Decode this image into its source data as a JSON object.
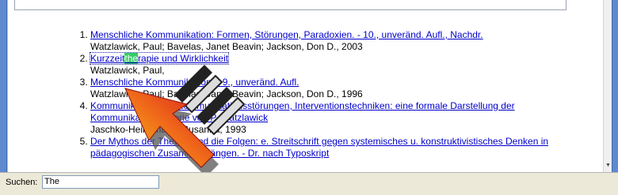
{
  "search": {
    "label": "Suchen:",
    "value": "The",
    "placeholder": ""
  },
  "results": [
    {
      "number": "1.",
      "title": "Menschliche Kommunikation: Formen, Störungen, Paradoxien. - 10., unveränd. Aufl., Nachdr.",
      "authors": "Watzlawick, Paul; Bavelas, Janet Beavin; Jackson, Don D., 2003"
    },
    {
      "number": "2.",
      "title_pre": "Kurzzeit",
      "title_hl": "the",
      "title_post": "rapie und Wirklichkeit",
      "authors": "Watzlawick, Paul,"
    },
    {
      "number": "3.",
      "title": "Menschliche Kommunikation. - 9., unveränd. Aufl.",
      "authors": "Watzlawick, Paul; Bavelas, Janet Beavin; Jackson, Don D., 1996"
    },
    {
      "number": "4.",
      "title": "Kommunikation und Kommunikationsstörungen, Interventionstechniken: eine formale Darstellung der Kommunikationstheorie von P. Watzlawick",
      "authors": "Jaschko-Heinemann, Susanna, 1993"
    },
    {
      "number": "5.",
      "title": "Der Mythos der Theorie und die Folgen: e. Streitschrift gegen systemisches u. konstruktivistisches Denken in pädagogischen Zusammenhängen. - Dr. nach Typoskript",
      "authors": ""
    }
  ],
  "overlay": {
    "icon": "red-arrow-cursor-icon"
  },
  "colors": {
    "link": "#0000cc",
    "highlight": "#33cc66",
    "frame": "#5f8ad0"
  }
}
